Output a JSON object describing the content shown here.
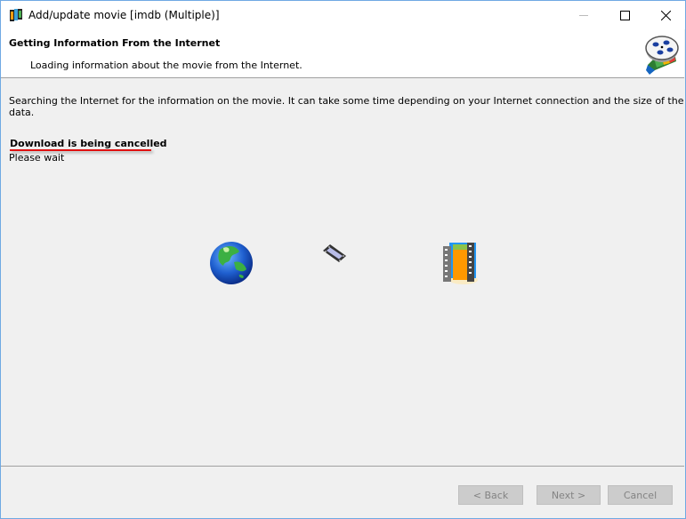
{
  "window": {
    "title": "Add/update movie [imdb (Multiple)]",
    "app_icon": "film-strip-icon",
    "controls": {
      "minimize": "minimize-icon",
      "maximize": "maximize-icon",
      "close": "close-icon"
    }
  },
  "header": {
    "title": "Getting Information From the Internet",
    "subtitle": "Loading information about the movie from the Internet.",
    "icon": "film-reel-icon"
  },
  "body": {
    "description": "Searching the Internet for the information on the movie. It can take some time depending on your Internet connection and the size of the data.",
    "status": "Download is being cancelled",
    "status_note": "Please wait",
    "animation_icons": [
      "globe-icon",
      "film-frame-icon",
      "film-collection-icon"
    ]
  },
  "footer": {
    "back_label": "< Back",
    "next_label": "Next >",
    "cancel_label": "Cancel"
  },
  "colors": {
    "accent_border": "#6fa9e3",
    "status_underline": "#e01010",
    "disabled_button": "#cccccc"
  }
}
